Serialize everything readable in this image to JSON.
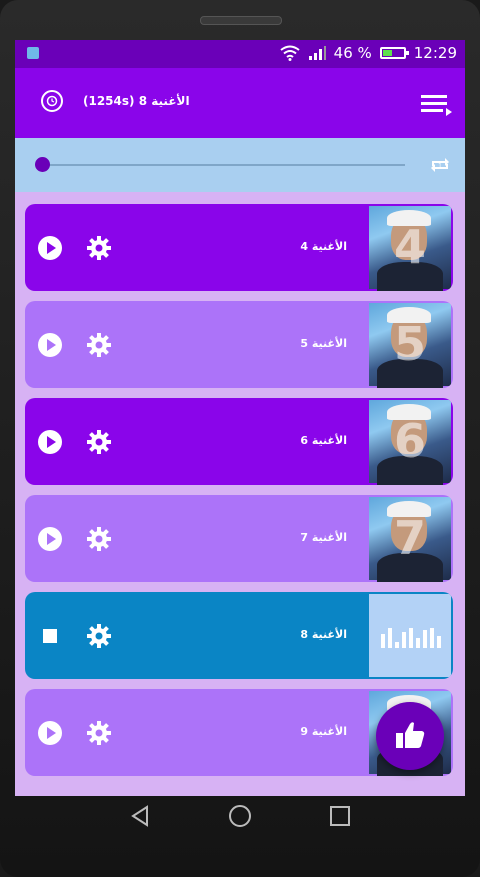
{
  "status": {
    "battery_text": "46 %",
    "battery_level": 0.46,
    "time": "12:29"
  },
  "appbar": {
    "title": "الأغنية 8 (1254s)",
    "logo_icon": "clock-music-icon",
    "menu_icon": "playlist-icon"
  },
  "player": {
    "progress": 0.0,
    "repeat_icon": "repeat-one-icon"
  },
  "songs": [
    {
      "label": "الأغنية 4",
      "number": "4",
      "style": "dark",
      "state": "play"
    },
    {
      "label": "الأغنية 5",
      "number": "5",
      "style": "light",
      "state": "play"
    },
    {
      "label": "الأغنية 6",
      "number": "6",
      "style": "dark",
      "state": "play"
    },
    {
      "label": "الأغنية 7",
      "number": "7",
      "style": "light",
      "state": "play"
    },
    {
      "label": "الأغنية 8",
      "number": "",
      "style": "active",
      "state": "stop"
    },
    {
      "label": "الأغنية 9",
      "number": "9",
      "style": "light",
      "state": "play"
    }
  ],
  "fab": {
    "icon": "thumbs-up-icon"
  },
  "colors": {
    "primary": "#8a05ea",
    "primary_dark": "#6a00b8",
    "light_item": "#ac73f9",
    "active_item": "#0a85c5",
    "seek_bg": "#a9cff0",
    "screen_bg": "#d7b2f4"
  }
}
